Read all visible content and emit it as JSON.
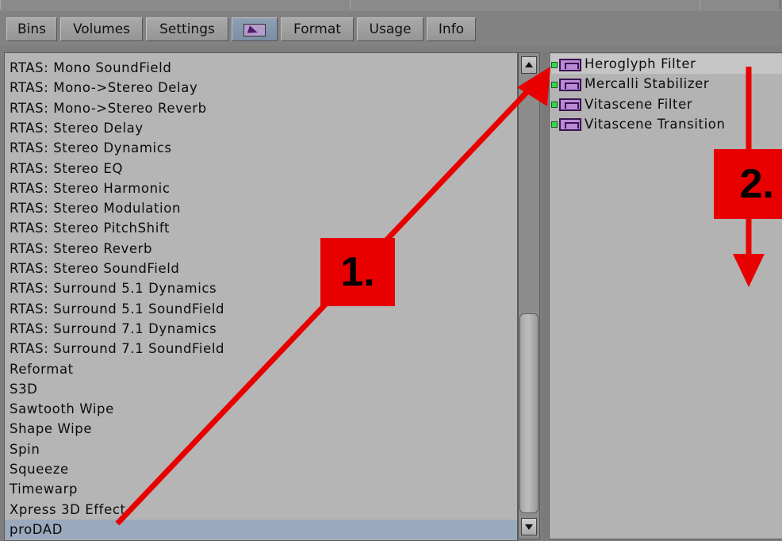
{
  "tabs": [
    {
      "label": "Bins"
    },
    {
      "label": "Volumes"
    },
    {
      "label": "Settings"
    },
    {
      "label": "",
      "icon": "effects-palette-icon",
      "active": true
    },
    {
      "label": "Format"
    },
    {
      "label": "Usage"
    },
    {
      "label": "Info"
    }
  ],
  "categories": [
    "RTAS: Mono SoundField",
    "RTAS: Mono->Stereo Delay",
    "RTAS: Mono->Stereo Reverb",
    "RTAS: Stereo Delay",
    "RTAS: Stereo Dynamics",
    "RTAS: Stereo EQ",
    "RTAS: Stereo Harmonic",
    "RTAS: Stereo Modulation",
    "RTAS: Stereo PitchShift",
    "RTAS: Stereo Reverb",
    "RTAS: Stereo SoundField",
    "RTAS: Surround 5.1 Dynamics",
    "RTAS: Surround 5.1 SoundField",
    "RTAS: Surround 7.1 Dynamics",
    "RTAS: Surround 7.1 SoundField",
    "Reformat",
    "S3D",
    "Sawtooth Wipe",
    "Shape Wipe",
    "Spin",
    "Squeeze",
    "Timewarp",
    "Xpress 3D Effect",
    "proDAD"
  ],
  "selected_category": "proDAD",
  "effects": [
    "Heroglyph Filter",
    "Mercalli Stabilizer",
    "Vitascene Filter",
    "Vitascene Transition"
  ],
  "annotations": {
    "step1": "1.",
    "step2": "2.",
    "color": "#e80000"
  },
  "colors": {
    "panel_bg": "#b5b5b5",
    "selection": "#9aa9bd",
    "effect_icon": "#b98bd6",
    "status_dot": "#35d64a"
  }
}
